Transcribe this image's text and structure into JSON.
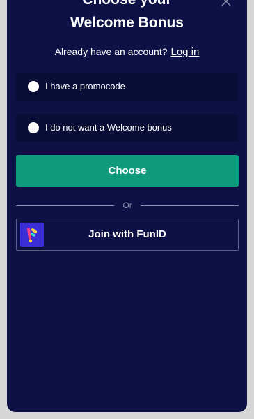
{
  "header": {
    "title_line1": "Choose your",
    "title_line2": "Welcome Bonus"
  },
  "login": {
    "prompt": "Already have an account?",
    "link_label": "Log in"
  },
  "options": [
    {
      "label": "I have a promocode"
    },
    {
      "label": "I do not want a Welcome bonus"
    }
  ],
  "actions": {
    "choose_label": "Choose",
    "divider_text": "Or",
    "funid_label": "Join with FunID"
  },
  "icons": {
    "close": "close-icon",
    "funid_logo": "funid-logo-icon"
  },
  "colors": {
    "background": "#0d1145",
    "option_bg": "#0a0d35",
    "primary_button": "#0f9a7c",
    "funid_logo_bg": "#3b2fd6"
  }
}
